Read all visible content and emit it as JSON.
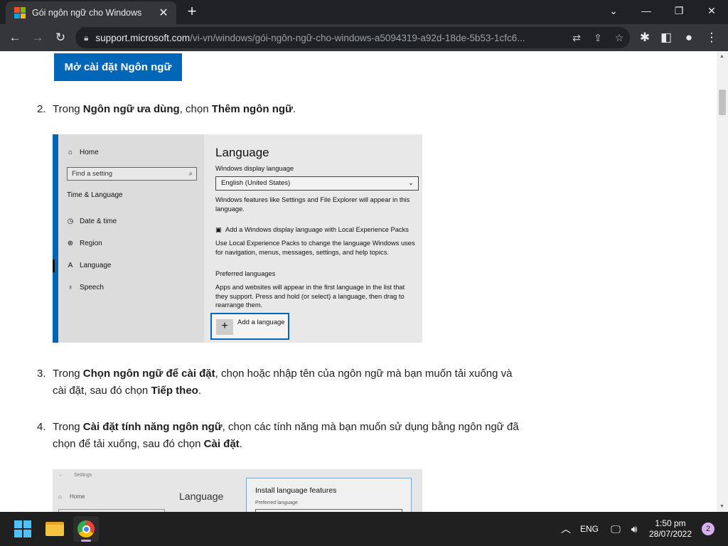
{
  "browser": {
    "tab_title": "Gói ngôn ngữ cho Windows",
    "url_host": "support.microsoft.com",
    "url_path": "/vi-vn/windows/gói-ngôn-ngữ-cho-windows-a5094319-a92d-18de-5b53-1cfc6..."
  },
  "page": {
    "open_button": "Mở cài đặt Ngôn ngữ",
    "step2": {
      "num": "2.",
      "p1": "Trong ",
      "b1": "Ngôn ngữ ưa dùng",
      "p2": ", chọn ",
      "b2": "Thêm ngôn ngữ",
      "p3": "."
    },
    "step3": {
      "num": "3.",
      "p1": "Trong ",
      "b1": "Chọn ngôn ngữ để cài đặt",
      "p2": ", chọn hoặc nhập tên của ngôn ngữ mà bạn muốn tải xuống và cài đặt, sau đó chọn ",
      "b2": "Tiếp theo",
      "p3": "."
    },
    "step4": {
      "num": "4.",
      "p1": "Trong ",
      "b1": "Cài đặt tính năng ngôn ngữ",
      "p2": ", chọn các tính năng mà bạn muốn sử dụng bằng ngôn ngữ đã chọn để tải xuống, sau đó chọn ",
      "b2": "Cài đặt",
      "p3": "."
    }
  },
  "screenshot1": {
    "home": "Home",
    "find_placeholder": "Find a setting",
    "section": "Time & Language",
    "nav": [
      "Date & time",
      "Region",
      "Language",
      "Speech"
    ],
    "title": "Language",
    "display_lang_label": "Windows display language",
    "display_lang_value": "English (United States)",
    "display_lang_desc": "Windows features like Settings and File Explorer will appear in this language.",
    "add_display_lang": "Add a Windows display language with Local Experience Packs",
    "lep_desc": "Use Local Experience Packs to change the language Windows uses for navigation, menus, messages, settings, and help topics.",
    "preferred_label": "Preferred languages",
    "preferred_desc": "Apps and websites will appear in the first language in the list that they support. Press and hold (or select) a language, then drag to rearrange them.",
    "add_language": "Add a language"
  },
  "screenshot2": {
    "back_label": "Settings",
    "home": "Home",
    "title": "Language",
    "dialog_title": "Install language features",
    "preferred_language": "Preferred language"
  },
  "taskbar": {
    "lang": "ENG",
    "time": "1:50 pm",
    "date": "28/07/2022",
    "notifications": "2"
  },
  "colors": {
    "accent": "#0067b8",
    "settings_accent": "#0063b1",
    "chrome_dark": "#202124",
    "chrome_toolbar": "#35363a"
  }
}
